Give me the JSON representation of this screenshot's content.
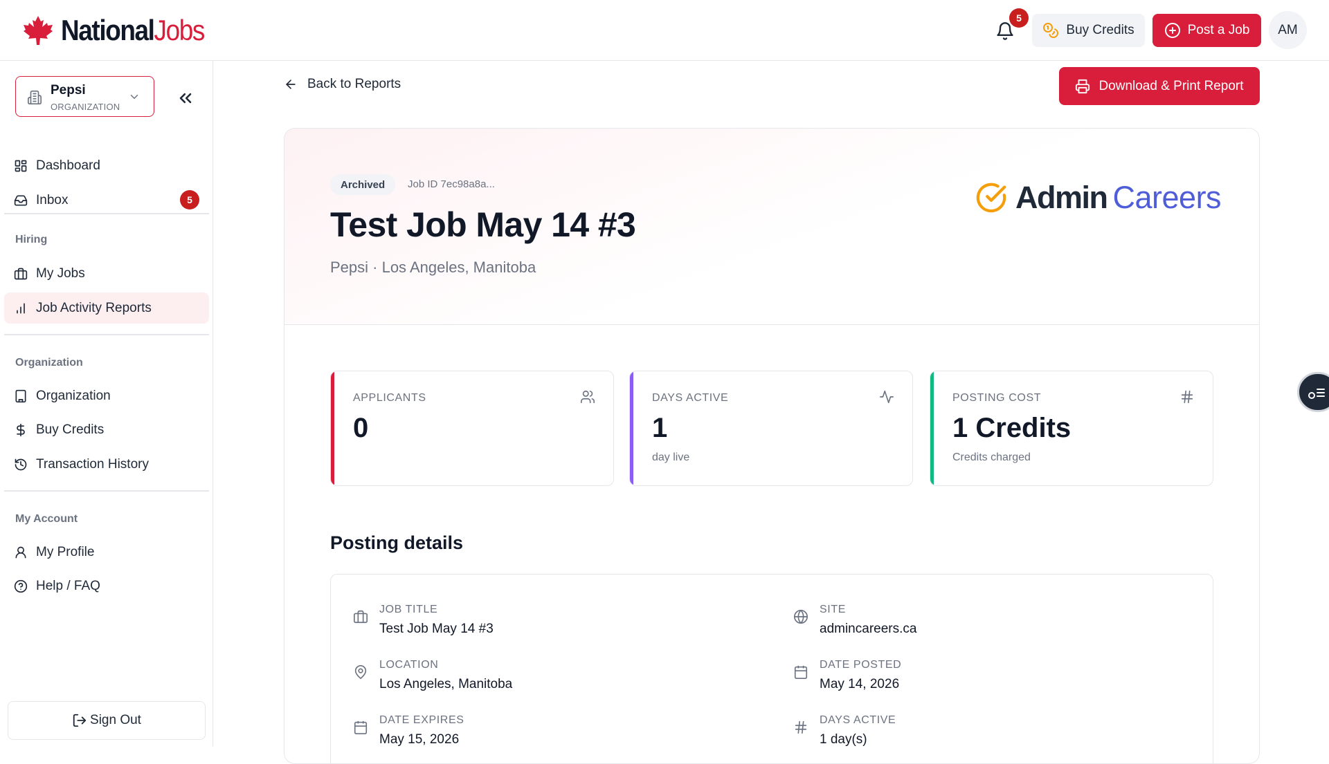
{
  "brand": {
    "word1": "National",
    "word2": "Jobs",
    "accent": "#d81e3b"
  },
  "header": {
    "notification_count": "5",
    "buy_credits_label": "Buy Credits",
    "post_job_label": "Post a Job",
    "avatar_initials": "AM"
  },
  "sidebar": {
    "org": {
      "name": "Pepsi",
      "type": "ORGANIZATION"
    },
    "items": [
      {
        "label": "Dashboard",
        "icon": "grid-icon"
      },
      {
        "label": "Inbox",
        "icon": "inbox-icon",
        "badge": "5"
      },
      {
        "label": "My Jobs",
        "icon": "briefcase-icon"
      },
      {
        "label": "Job Activity Reports",
        "icon": "bar-chart-icon",
        "active": true
      },
      {
        "label": "Organization",
        "icon": "building-icon"
      },
      {
        "label": "Buy Credits",
        "icon": "dollar-icon"
      },
      {
        "label": "Transaction History",
        "icon": "history-icon"
      },
      {
        "label": "My Profile",
        "icon": "user-icon"
      },
      {
        "label": "Help / FAQ",
        "icon": "help-icon"
      }
    ],
    "sections": {
      "hiring": "Hiring",
      "organization": "Organization",
      "account": "My Account"
    },
    "sign_out": "Sign Out"
  },
  "main": {
    "back_label": "Back to Reports",
    "download_label": "Download & Print Report",
    "job": {
      "status": "Archived",
      "job_id": "Job ID 7ec98a8a...",
      "title": "Test Job May 14 #3",
      "subline": "Pepsi · Los Angeles, Manitoba",
      "site_logo_word1": "Admin",
      "site_logo_word2": "Careers"
    },
    "stats": [
      {
        "label": "APPLICANTS",
        "value": "0",
        "hint": "",
        "color": "#d81e3b",
        "icon": "users-icon"
      },
      {
        "label": "DAYS ACTIVE",
        "value": "1",
        "hint": "day live",
        "color": "#8b5cf6",
        "icon": "activity-icon"
      },
      {
        "label": "POSTING COST",
        "value": "1 Credits",
        "hint": "Credits charged",
        "color": "#10b981",
        "icon": "hash-icon"
      }
    ],
    "details_heading": "Posting details",
    "details": {
      "job_title": {
        "label": "JOB TITLE",
        "value": "Test Job May 14 #3"
      },
      "site": {
        "label": "SITE",
        "value": "admincareers.ca"
      },
      "location": {
        "label": "LOCATION",
        "value": "Los Angeles, Manitoba"
      },
      "date_posted": {
        "label": "DATE POSTED",
        "value": "May 14, 2026"
      },
      "date_expires": {
        "label": "DATE EXPIRES",
        "value": "May 15, 2026"
      },
      "days_active": {
        "label": "DAYS ACTIVE",
        "value": "1 day(s)"
      }
    }
  }
}
